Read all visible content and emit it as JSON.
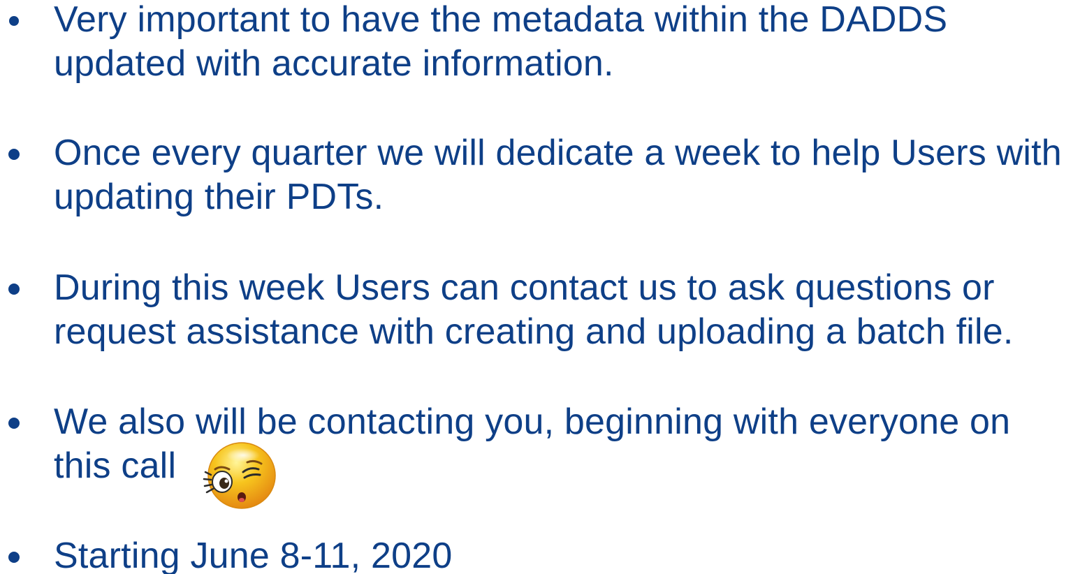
{
  "bullets": [
    {
      "lines": [
        "Very important to have the metadata within the DADDS",
        "updated with accurate information."
      ]
    },
    {
      "lines": [
        "Once every quarter we will dedicate a week to help Users with",
        "updating their PDTs."
      ]
    },
    {
      "lines": [
        "During this week Users can contact us to ask questions or",
        "request assistance with creating and uploading a batch file."
      ]
    },
    {
      "lines": [
        "We also will be contacting you, beginning with everyone on",
        "this call"
      ]
    },
    {
      "lines": [
        "Starting June 8-11, 2020"
      ]
    }
  ],
  "colors": {
    "text": "#0e3f87",
    "background": "#ffffff",
    "emoji_face": "#f7c51e",
    "emoji_shade": "#e58a12"
  },
  "icons": {
    "emoji": "winking-face-icon"
  }
}
